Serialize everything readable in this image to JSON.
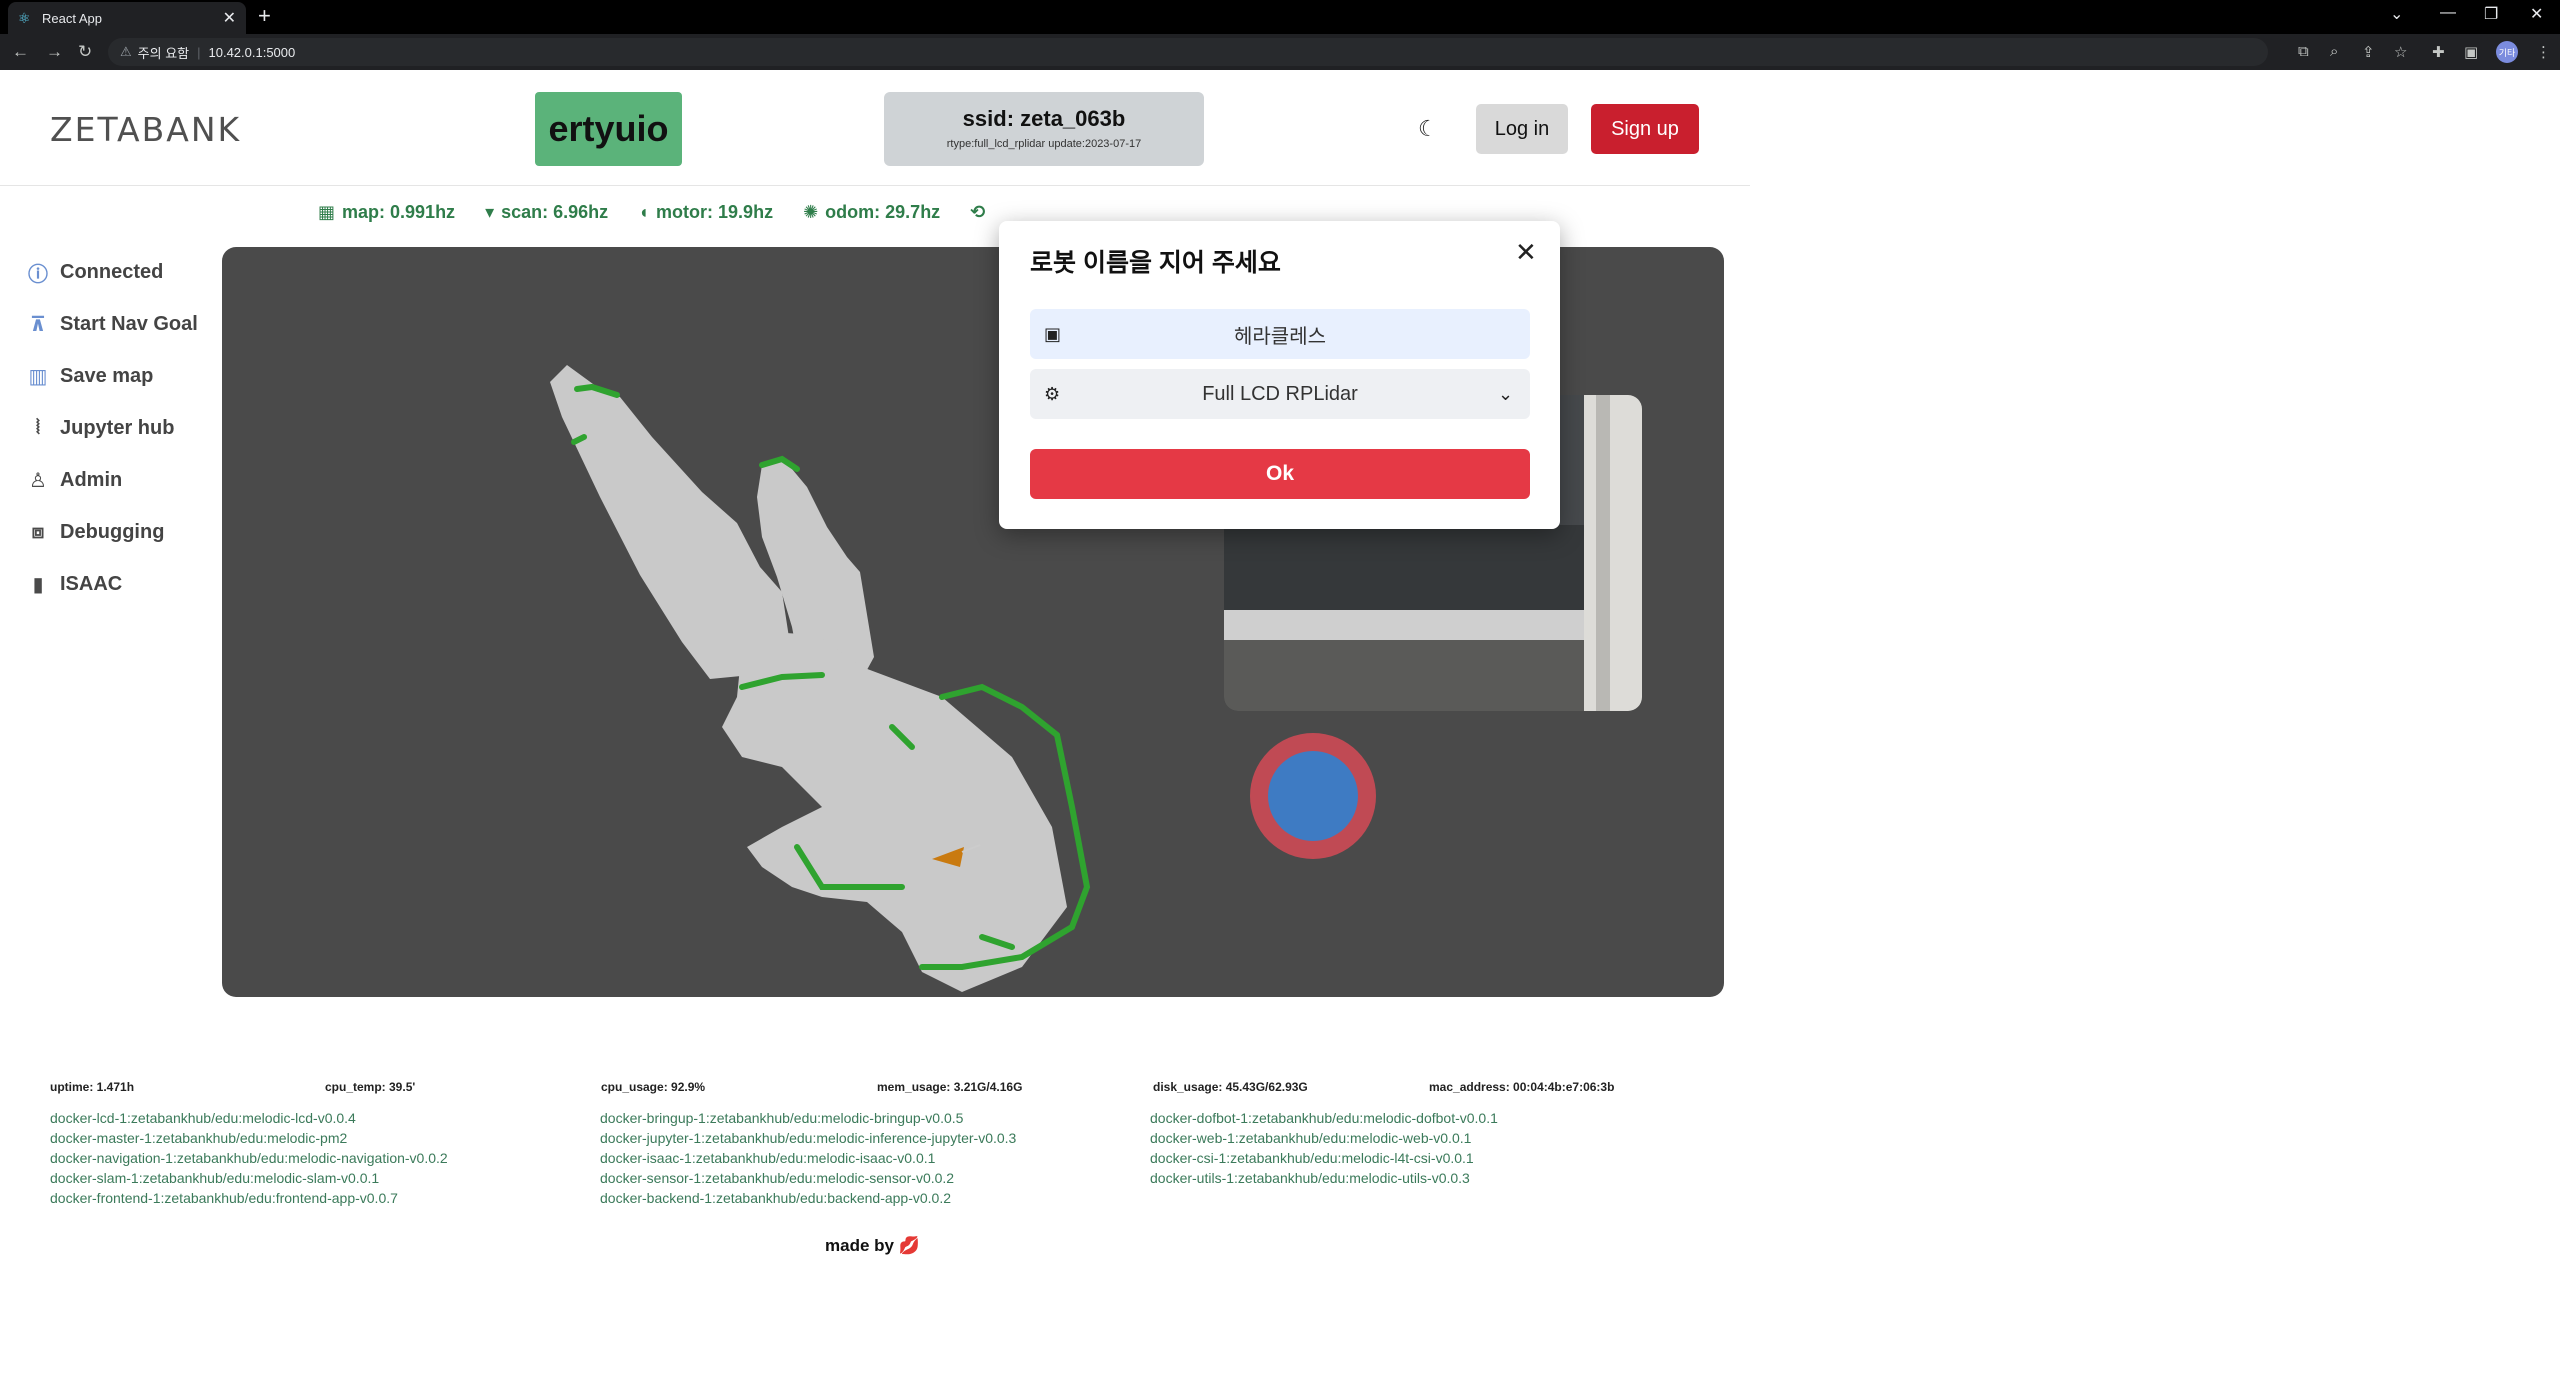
{
  "browser": {
    "tab_title": "React App",
    "tab_favicon": "react-icon",
    "new_tab": "+",
    "url_warning": "주의 요함",
    "url": "10.42.0.1:5000",
    "profile_initials": "기타"
  },
  "header": {
    "brand": "ZETABANK",
    "robot_name": "ertyuio",
    "ssid": "ssid: zeta_063b",
    "ssid_meta": "rtype:full_lcd_rplidar update:2023-07-17",
    "login_label": "Log in",
    "signup_label": "Sign up"
  },
  "hz": [
    {
      "icon": "grid-icon",
      "label": "map: 0.991hz"
    },
    {
      "icon": "wifi-icon",
      "label": "scan: 6.96hz"
    },
    {
      "icon": "motor-icon",
      "label": "motor: 19.9hz"
    },
    {
      "icon": "gear-icon",
      "label": "odom: 29.7hz"
    }
  ],
  "sidebar": {
    "items": [
      {
        "icon": "connected-icon",
        "label": "Connected"
      },
      {
        "icon": "navigation-icon",
        "label": "Start Nav Goal"
      },
      {
        "icon": "map-icon",
        "label": "Save map"
      },
      {
        "icon": "jupyter-icon",
        "label": "Jupyter hub"
      },
      {
        "icon": "admin-icon",
        "label": "Admin"
      },
      {
        "icon": "debug-icon",
        "label": "Debugging"
      },
      {
        "icon": "chart-icon",
        "label": "ISAAC"
      }
    ]
  },
  "system": {
    "uptime": "uptime: 1.471h",
    "cpu_temp": "cpu_temp: 39.5'",
    "cpu_usage": "cpu_usage: 92.9%",
    "mem_usage": "mem_usage: 3.21G/4.16G",
    "disk_usage": "disk_usage: 45.43G/62.93G",
    "mac_address": "mac_address: 00:04:4b:e7:06:3b"
  },
  "dockers": {
    "col1": [
      "docker-lcd-1:zetabankhub/edu:melodic-lcd-v0.0.4",
      "docker-master-1:zetabankhub/edu:melodic-pm2",
      "docker-navigation-1:zetabankhub/edu:melodic-navigation-v0.0.2",
      "docker-slam-1:zetabankhub/edu:melodic-slam-v0.0.1",
      "docker-frontend-1:zetabankhub/edu:frontend-app-v0.0.7"
    ],
    "col2": [
      "docker-bringup-1:zetabankhub/edu:melodic-bringup-v0.0.5",
      "docker-jupyter-1:zetabankhub/edu:melodic-inference-jupyter-v0.0.3",
      "docker-isaac-1:zetabankhub/edu:melodic-isaac-v0.0.1",
      "docker-sensor-1:zetabankhub/edu:melodic-sensor-v0.0.2",
      "docker-backend-1:zetabankhub/edu:backend-app-v0.0.2"
    ],
    "col3": [
      "docker-dofbot-1:zetabankhub/edu:melodic-dofbot-v0.0.1",
      "docker-web-1:zetabankhub/edu:melodic-web-v0.0.1",
      "docker-csi-1:zetabankhub/edu:melodic-l4t-csi-v0.0.1",
      "docker-utils-1:zetabankhub/edu:melodic-utils-v0.0.3"
    ]
  },
  "footer": {
    "made_by": "made by 💋"
  },
  "modal": {
    "title": "로봇 이름을 지어 주세요",
    "name_value": "헤라클레스",
    "type_value": "Full LCD RPLidar",
    "ok_label": "Ok"
  }
}
